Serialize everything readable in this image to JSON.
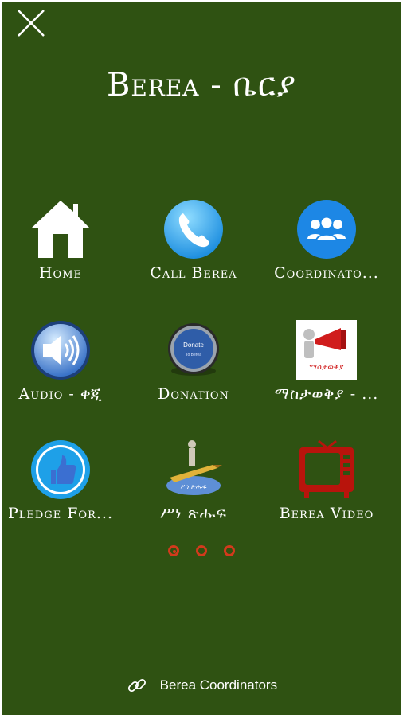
{
  "header": {
    "title": "Berea - ቤርያ"
  },
  "tiles": [
    {
      "label": "Home",
      "icon": "home-icon"
    },
    {
      "label": "Call Berea",
      "icon": "phone-icon"
    },
    {
      "label": "Coordinato...",
      "icon": "group-icon"
    },
    {
      "label": "Audio - ቀጂ",
      "icon": "speaker-icon"
    },
    {
      "label": "Donation",
      "icon": "donate-button-icon"
    },
    {
      "label": "ማስታወቅያ - ...",
      "icon": "megaphone-icon"
    },
    {
      "label": "Pledge For...",
      "icon": "thumbs-up-icon"
    },
    {
      "label": "ሥነ ጽሑፍ",
      "icon": "pen-figure-icon"
    },
    {
      "label": "Berea Video",
      "icon": "tv-icon"
    }
  ],
  "badges": {
    "donate_top": "Donate",
    "donate_bottom": "To Berea",
    "megaphone_text": "ማስታወቅያ",
    "pen_text": "ሥነ ጽሑፍ"
  },
  "pagination": {
    "pages": 3,
    "current": 1
  },
  "footer": {
    "link_text": "Berea Coordinators"
  },
  "colors": {
    "background": "#2f5212",
    "accent": "#d23a1c"
  }
}
